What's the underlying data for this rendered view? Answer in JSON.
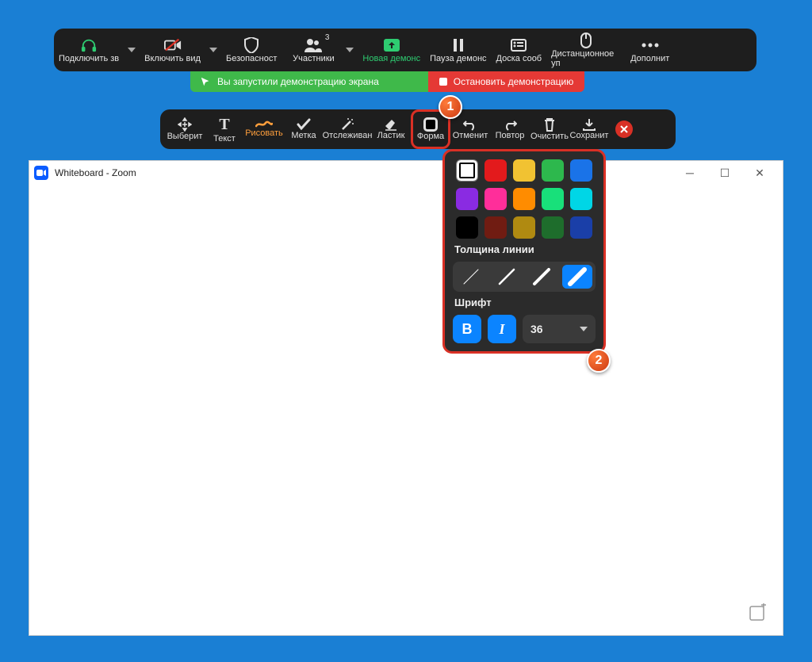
{
  "meeting_toolbar": {
    "audio": "Подключить зв",
    "video": "Включить вид",
    "security": "Безопасност",
    "participants": "Участники",
    "participants_count": "3",
    "new_share": "Новая демонс",
    "pause_share": "Пауза демонс",
    "whiteboard": "Доска сооб",
    "remote": "Дистанционное уп",
    "more": "Дополнит"
  },
  "sharing_bar": {
    "status": "Вы запустили демонстрацию экрана",
    "stop": "Остановить демонстрацию"
  },
  "anno": {
    "select": "Выберит",
    "text": "Текст",
    "draw": "Рисовать",
    "stamp": "Метка",
    "spotlight": "Отслеживан",
    "eraser": "Ластик",
    "format": "Форма",
    "undo": "Отменит",
    "redo": "Повтор",
    "clear": "Очистить",
    "save": "Сохранит"
  },
  "format_pop": {
    "colors_row1": [
      "#ffffff",
      "#e31a1c",
      "#f1c232",
      "#2db84d",
      "#1a73e8"
    ],
    "colors_row2": [
      "#8a2be2",
      "#ff2e9a",
      "#ff8c00",
      "#18e07a",
      "#00d6e6"
    ],
    "colors_row3": [
      "#000000",
      "#701c12",
      "#b08a11",
      "#1e6d2c",
      "#1a3fa8"
    ],
    "thickness_label": "Толщина линии",
    "font_label": "Шрифт",
    "bold": "B",
    "italic": "I",
    "font_size": "36"
  },
  "whiteboard": {
    "title": "Whiteboard - Zoom"
  },
  "badges": {
    "one": "1",
    "two": "2"
  }
}
